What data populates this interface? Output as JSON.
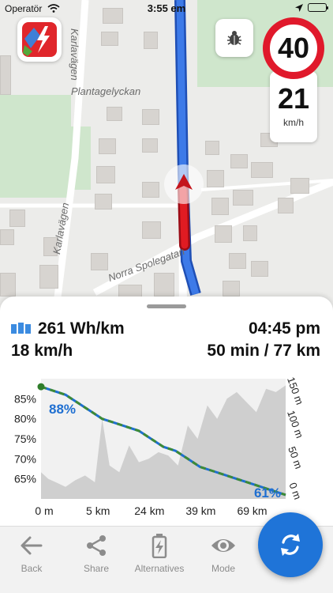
{
  "status_bar": {
    "carrier": "Operatör",
    "time": "3:55 em"
  },
  "map": {
    "labels": [
      {
        "key": "karlavagen_top",
        "text": "Karlavägen"
      },
      {
        "key": "plantagelyckan",
        "text": "Plantagelyckan"
      },
      {
        "key": "karlavagen_mid",
        "text": "Karlavägen"
      },
      {
        "key": "norra_spolegatan",
        "text": "Norra Spolegatan"
      }
    ]
  },
  "speed": {
    "limit": "40",
    "current": "21",
    "unit": "km/h"
  },
  "stats": {
    "consumption": "261 Wh/km",
    "speed": "18 km/h",
    "arrival": "04:45 pm",
    "duration_distance": "50 min / 77 km"
  },
  "chart_data": {
    "type": "line",
    "x_ticks": [
      "0 m",
      "5 km",
      "24 km",
      "39 km",
      "69 km"
    ],
    "y_left_ticks": [
      "85%",
      "80%",
      "75%",
      "70%",
      "65%"
    ],
    "y_right_ticks": [
      "150 m",
      "100 m",
      "50 m",
      "0 m"
    ],
    "start_label": "88%",
    "end_label": "61%",
    "battery_series": {
      "x": [
        0,
        0.05,
        0.1,
        0.15,
        0.2,
        0.25,
        0.3,
        0.35,
        0.4,
        0.45,
        0.5,
        0.55,
        0.6,
        0.65,
        0.7,
        0.75,
        0.8,
        0.85,
        0.9,
        0.95,
        1.0
      ],
      "y": [
        88,
        87,
        86,
        84,
        82,
        80,
        79,
        78,
        77,
        75,
        73,
        72,
        70,
        68,
        67,
        66,
        65,
        64,
        63,
        62,
        61
      ]
    },
    "elevation_series": {
      "x": [
        0,
        0.03,
        0.06,
        0.1,
        0.14,
        0.18,
        0.22,
        0.25,
        0.28,
        0.32,
        0.36,
        0.4,
        0.44,
        0.48,
        0.52,
        0.56,
        0.6,
        0.64,
        0.68,
        0.72,
        0.76,
        0.8,
        0.84,
        0.88,
        0.92,
        0.96,
        1.0
      ],
      "y": [
        30,
        20,
        15,
        8,
        18,
        25,
        15,
        110,
        40,
        30,
        70,
        45,
        50,
        60,
        55,
        40,
        100,
        80,
        130,
        110,
        140,
        150,
        135,
        120,
        155,
        150,
        160
      ]
    },
    "colors": {
      "battery_line": "#1f6fd1",
      "battery_dash": "#3d8a36",
      "elevation_fill": "#cfcfcf",
      "label": "#1f6fd1"
    }
  },
  "tabs": [
    {
      "key": "back",
      "label": "Back",
      "icon": "back-arrow-icon"
    },
    {
      "key": "share",
      "label": "Share",
      "icon": "share-icon"
    },
    {
      "key": "alternatives",
      "label": "Alternatives",
      "icon": "battery-bolt-icon"
    },
    {
      "key": "mode",
      "label": "Mode",
      "icon": "eye-icon"
    }
  ],
  "fab": {
    "icon": "refresh-icon"
  }
}
